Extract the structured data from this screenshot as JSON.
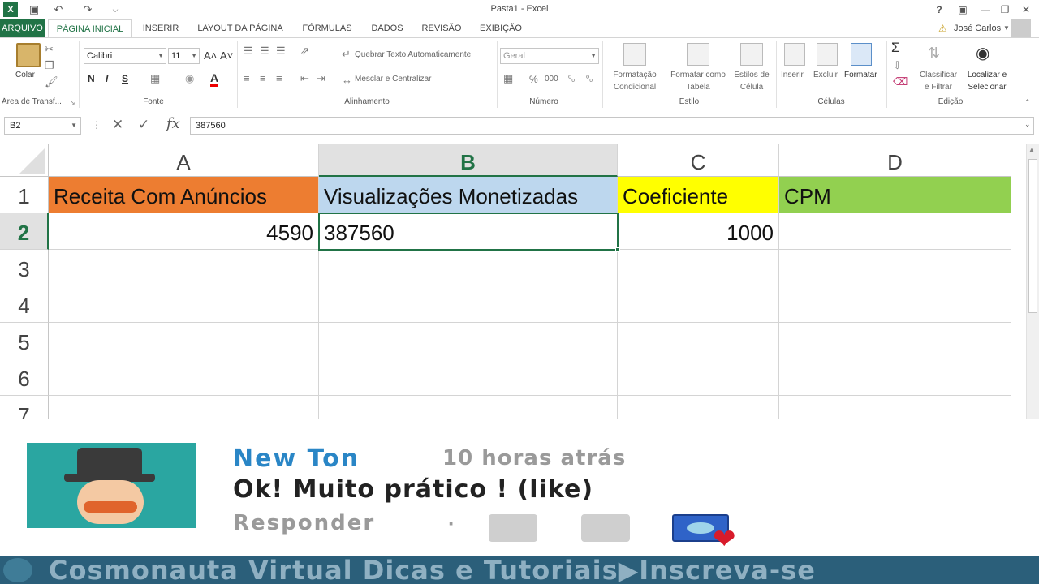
{
  "window": {
    "title": "Pasta1 - Excel",
    "help": "?",
    "min": "—",
    "restore": "❐",
    "close": "✕"
  },
  "quick_access": {
    "undo": "↶",
    "redo": "↷",
    "save": "▣",
    "more": "⌵"
  },
  "tabs": [
    "ARQUIVO",
    "PÁGINA INICIAL",
    "INSERIR",
    "LAYOUT DA PÁGINA",
    "FÓRMULAS",
    "DADOS",
    "REVISÃO",
    "EXIBIÇÃO"
  ],
  "user": "José Carlos",
  "ribbon": {
    "clipboard": {
      "paste": "Colar",
      "label": "Área de Transf..."
    },
    "font": {
      "name": "Calibri",
      "size": "11",
      "bold": "N",
      "italic": "I",
      "underline": "S",
      "grow": "A˄",
      "shrink": "A˅",
      "label": "Fonte"
    },
    "alignment": {
      "wrap": "Quebrar Texto Automaticamente",
      "merge": "Mesclar e Centralizar",
      "label": "Alinhamento"
    },
    "number": {
      "format": "Geral",
      "percent": "%",
      "thousands": "000",
      "inc": "⁰₀",
      "dec": "⁰₀",
      "label": "Número"
    },
    "styles": {
      "conditional": [
        "Formatação",
        "Condicional"
      ],
      "table": [
        "Formatar como",
        "Tabela"
      ],
      "cell": [
        "Estilos de",
        "Célula"
      ],
      "label": "Estilo"
    },
    "cells": {
      "insert": "Inserir",
      "delete": "Excluir",
      "format": "Formatar",
      "label": "Células"
    },
    "editing": {
      "sort": [
        "Classificar",
        "e Filtrar"
      ],
      "find": [
        "Localizar e",
        "Selecionar"
      ],
      "label": "Edição"
    }
  },
  "formula_bar": {
    "name_box": "B2",
    "cancel": "✕",
    "enter": "✓",
    "fx": "fx",
    "content": "387560"
  },
  "sheet": {
    "columns": [
      "A",
      "B",
      "C",
      "D"
    ],
    "rows": [
      "1",
      "2",
      "3",
      "4",
      "5",
      "6",
      "7"
    ],
    "cells": {
      "A1": "Receita Com Anúncios",
      "B1": "Visualizações Monetizadas",
      "C1": "Coeficiente",
      "D1": "CPM",
      "A2": "4590",
      "B2": "387560",
      "C2": "1000"
    },
    "colors": {
      "A1": "#ed7d31",
      "B1": "#bdd7ee",
      "C1": "#ffff00",
      "D1": "#92d050",
      "accent": "#217346"
    }
  },
  "comment": {
    "author": "New Ton",
    "time": "10 horas atrás",
    "text": "Ok! Muito prático ! (like)",
    "reply": "Responder",
    "dot": "·"
  },
  "banner": {
    "text": "Cosmonauta Virtual Dicas e Tutoriais▶Inscreva-se"
  }
}
